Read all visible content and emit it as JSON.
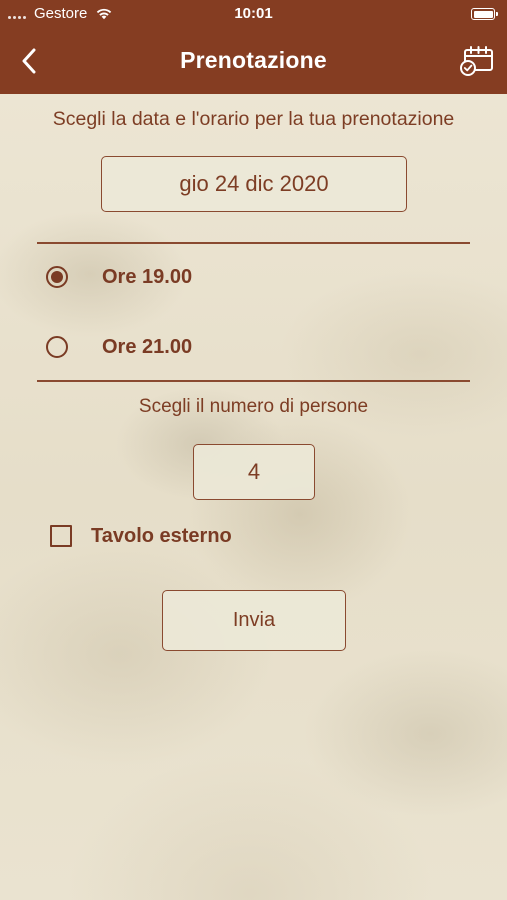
{
  "status_bar": {
    "carrier": "Gestore",
    "time": "10:01"
  },
  "nav": {
    "title": "Prenotazione",
    "back_icon": "chevron-left-icon",
    "calendar_icon": "calendar-check-icon"
  },
  "booking": {
    "instruction": "Scegli la data e l'orario per la tua prenotazione",
    "date_value": "gio 24 dic 2020",
    "time_slots": [
      {
        "label": "Ore 19.00",
        "selected": true
      },
      {
        "label": "Ore 21.00",
        "selected": false
      }
    ],
    "persons_label": "Scegli il numero di persone",
    "persons_value": "4",
    "outdoor_table_label": "Tavolo esterno",
    "outdoor_table_checked": false,
    "submit_label": "Invia"
  },
  "colors": {
    "brand": "#853d22",
    "text": "#7a3b24",
    "background": "#e9e1cd"
  }
}
